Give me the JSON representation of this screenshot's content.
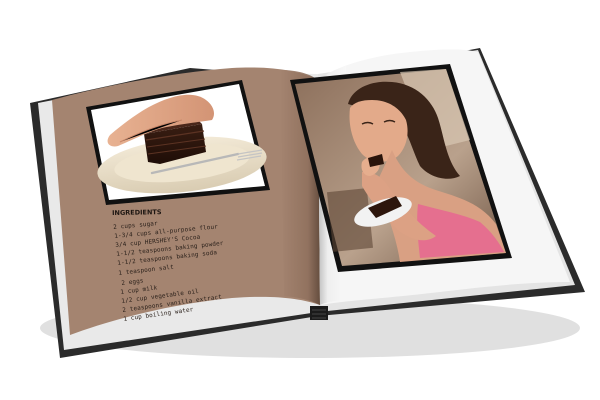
{
  "book": {
    "left_page": {
      "ingredients_heading": "INGREDIENTS",
      "ingredients": [
        "2 cups sugar",
        "1-3/4 cups all-purpose flour",
        "3/4 cup HERSHEY'S Cocoa",
        "1-1/2 teaspoons baking powder",
        "1-1/2 teaspoons baking soda",
        "1 teaspoon salt",
        "2 eggs",
        "1 cup milk",
        "1/2 cup vegetable oil",
        "2 teaspoons vanilla extract",
        "1 cup boiling water"
      ],
      "page_color": "#a48470"
    },
    "right_page": {
      "page_color": "#f6f6f6"
    },
    "cover_color": "#2b2b2b"
  }
}
